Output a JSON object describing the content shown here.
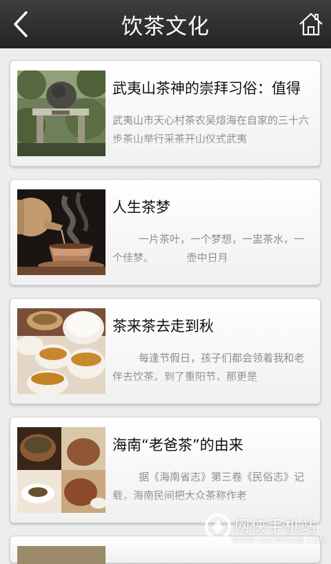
{
  "header": {
    "title": "饮茶文化",
    "back_icon": "back-arrow-icon",
    "home_icon": "home-icon"
  },
  "articles": [
    {
      "title": "武夷山茶神的崇拜习俗：值得",
      "desc": "武夷山市天心村茶农吴煊海在自家的三十六步茶山举行采茶开山仪式武夷"
    },
    {
      "title": "人生茶梦",
      "desc": "        一片茶叶，一个梦想，一盅茶水，一个佳梦。          壶中日月"
    },
    {
      "title": "茶来茶去走到秋",
      "desc": "        每逢节假日，孩子们都会领着我和老伴去饮茶。到了重阳节，那更是"
    },
    {
      "title": "海南“老爸茶”的由来",
      "desc": "        据《海南省志》第三卷《民俗志》记载，海南民间把大众茶称作老"
    }
  ],
  "watermark": {
    "name": "网侠手机站",
    "url": "WWW.HACKHOME.COM"
  }
}
